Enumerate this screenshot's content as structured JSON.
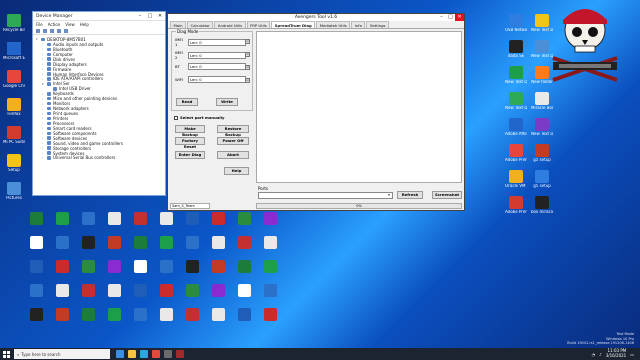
{
  "device_manager": {
    "title": "Device Manager",
    "menu": [
      "File",
      "Action",
      "View",
      "Help"
    ],
    "root": "DESKTOP-8M57B01",
    "items": [
      "Audio inputs and outputs",
      "Bluetooth",
      "Computer",
      "Disk drives",
      "Display adapters",
      "Firmware",
      "Human Interface Devices",
      "IDE ATA/ATAPI controllers",
      "Intel Ser",
      "Intel USB Driver",
      "Keyboards",
      "Mice and other pointing devices",
      "Monitors",
      "Network adapters",
      "Print queues",
      "Printers",
      "Processors",
      "Smart card readers",
      "Software components",
      "Software devices",
      "Sound, video and game controllers",
      "Storage controllers",
      "System devices",
      "Universal Serial Bus controllers"
    ]
  },
  "tool": {
    "title": "Avengers Tool v1.6",
    "tabs": [
      "Main",
      "Calculator",
      "Android Utils",
      "FRP Utils",
      "SpreadTrum Diag",
      "Mediatek Utils",
      "Info",
      "Settings"
    ],
    "active_tab": "SpreadTrum Diag",
    "group_label": "Diag Mode",
    "slots": [
      {
        "label": "IMEI 1",
        "value": "Len: 0"
      },
      {
        "label": "IMEI 2",
        "value": "Len: 0"
      },
      {
        "label": "BT",
        "value": "Len: 0"
      },
      {
        "label": "WIFI",
        "value": "Len: 0"
      }
    ],
    "read_btn": "Read",
    "write_btn": "Write",
    "select_port_label": "Select port manually",
    "buttons": {
      "make_backup": "Make Backup",
      "restore_backup": "Restore Backup",
      "factory_reset": "Factory Reset",
      "power_off": "Power Off",
      "enter_diag": "Enter Diag",
      "abort": "Abort",
      "help": "Help"
    },
    "ports_label": "Ports",
    "refresh_btn": "Refresh",
    "screenshot_btn": "Screenshot",
    "progress_text": "0%",
    "status_text": "Sam_S_Team"
  },
  "desktop_left": [
    "Recycle Bin",
    "Microsoft Edge",
    "Google Chrome",
    "Firefox",
    "Mi PC Suite",
    "Setup",
    "Pictures",
    "",
    "",
    "",
    "",
    "",
    "",
    ""
  ],
  "desktop_right": [
    "USB Network Gate",
    "dada SE",
    "New Text Document",
    "New Text Document",
    "Adobe After Effects",
    "Adobe Premiere Pro",
    "Oracle VM VirtualBox",
    "Adobe Premiere Pro",
    "New Text Document",
    "New Text Document",
    "New folder",
    "Miracle Box",
    "New Text Document",
    "g5 setup",
    "g5 setup",
    "box miracle"
  ],
  "taskbar": {
    "search_placeholder": "Type here to search",
    "time": "11:03 PM",
    "date": "3/16/2021"
  },
  "watermark": {
    "line1": "Test Mode",
    "line2": "Windows 10 Pro",
    "line3": "Build 19041.rs1_release.191206-1406"
  }
}
